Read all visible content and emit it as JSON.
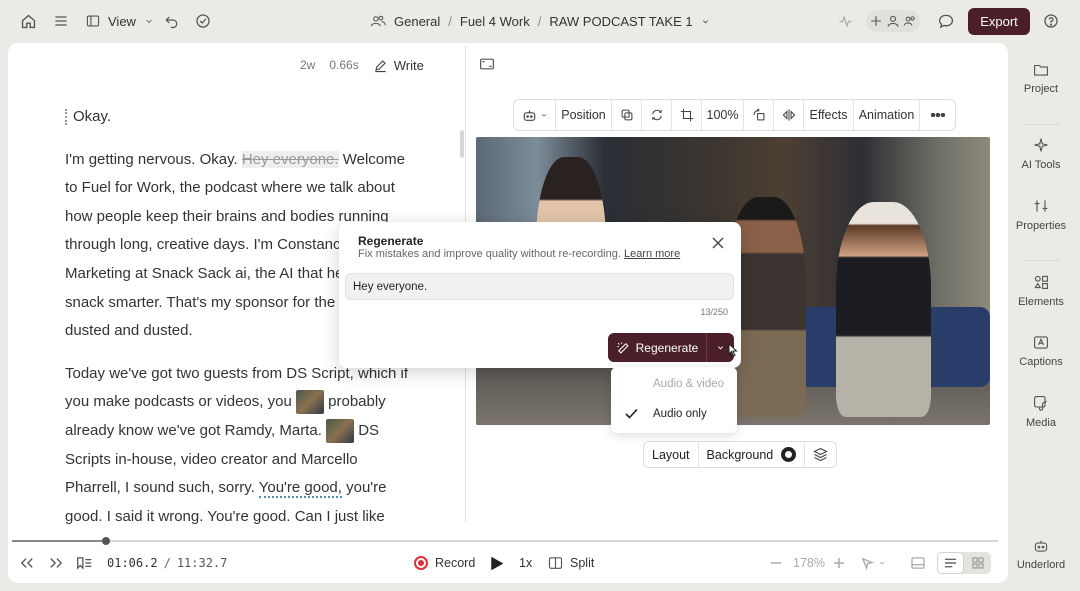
{
  "colors": {
    "accent": "#4a1f28",
    "record": "#d9343b",
    "link_underline": "#4b8ea3"
  },
  "topbar": {
    "view_label": "View",
    "breadcrumbs": [
      "General",
      "Fuel 4 Work",
      "RAW PODCAST TAKE 1"
    ],
    "export_label": "Export"
  },
  "script_header": {
    "words": "2w",
    "duration": "0.66s",
    "write_label": "Write"
  },
  "transcript": {
    "p1": "Okay.",
    "p2_a": "I'm getting nervous. Okay.",
    "p2_strike": "Hey everyone.",
    "p2_b": "Welcome to Fuel for Work, the podcast where we talk about how people keep their brains and bodies running through long, creative days. I'm Constance, Marketing at Snack Sack ai, the AI that helps you snack smarter. That's my sponsor for the day, dusted and dusted.",
    "p3_a": "Today we've got two guests from DS Script, which if you make podcasts or videos, you",
    "p3_b": "probably already know we've got Ramdy, Marta.",
    "p3_c": "DS Scripts in-house, video creator and Marcello Pharrell, I sound such, sorry.",
    "p3_good": "You're good,",
    "p3_d": "you're good. I said it wrong. You're good. Can I just like"
  },
  "toolbar": {
    "position": "Position",
    "zoom": "100%",
    "effects": "Effects",
    "animation": "Animation"
  },
  "canvas_controls": {
    "layout": "Layout",
    "background": "Background"
  },
  "dialog": {
    "title": "Regenerate",
    "subtitle": "Fix mistakes and improve quality without re-recording.",
    "learn_more": "Learn more",
    "input_value": "Hey everyone.",
    "char_count": "13/250",
    "button_label": "Regenerate"
  },
  "dropdown": {
    "options": [
      "Audio & video",
      "Audio only"
    ],
    "selected": "Audio only"
  },
  "sidebar": [
    "Project",
    "AI Tools",
    "Properties",
    "Elements",
    "Captions",
    "Media",
    "Underlord"
  ],
  "playback": {
    "current_time": "01:06.2",
    "separator": "/",
    "total_time": "11:32.7",
    "progress": 0.095,
    "record_label": "Record",
    "speed": "1x",
    "split_label": "Split",
    "zoom": "178%"
  }
}
